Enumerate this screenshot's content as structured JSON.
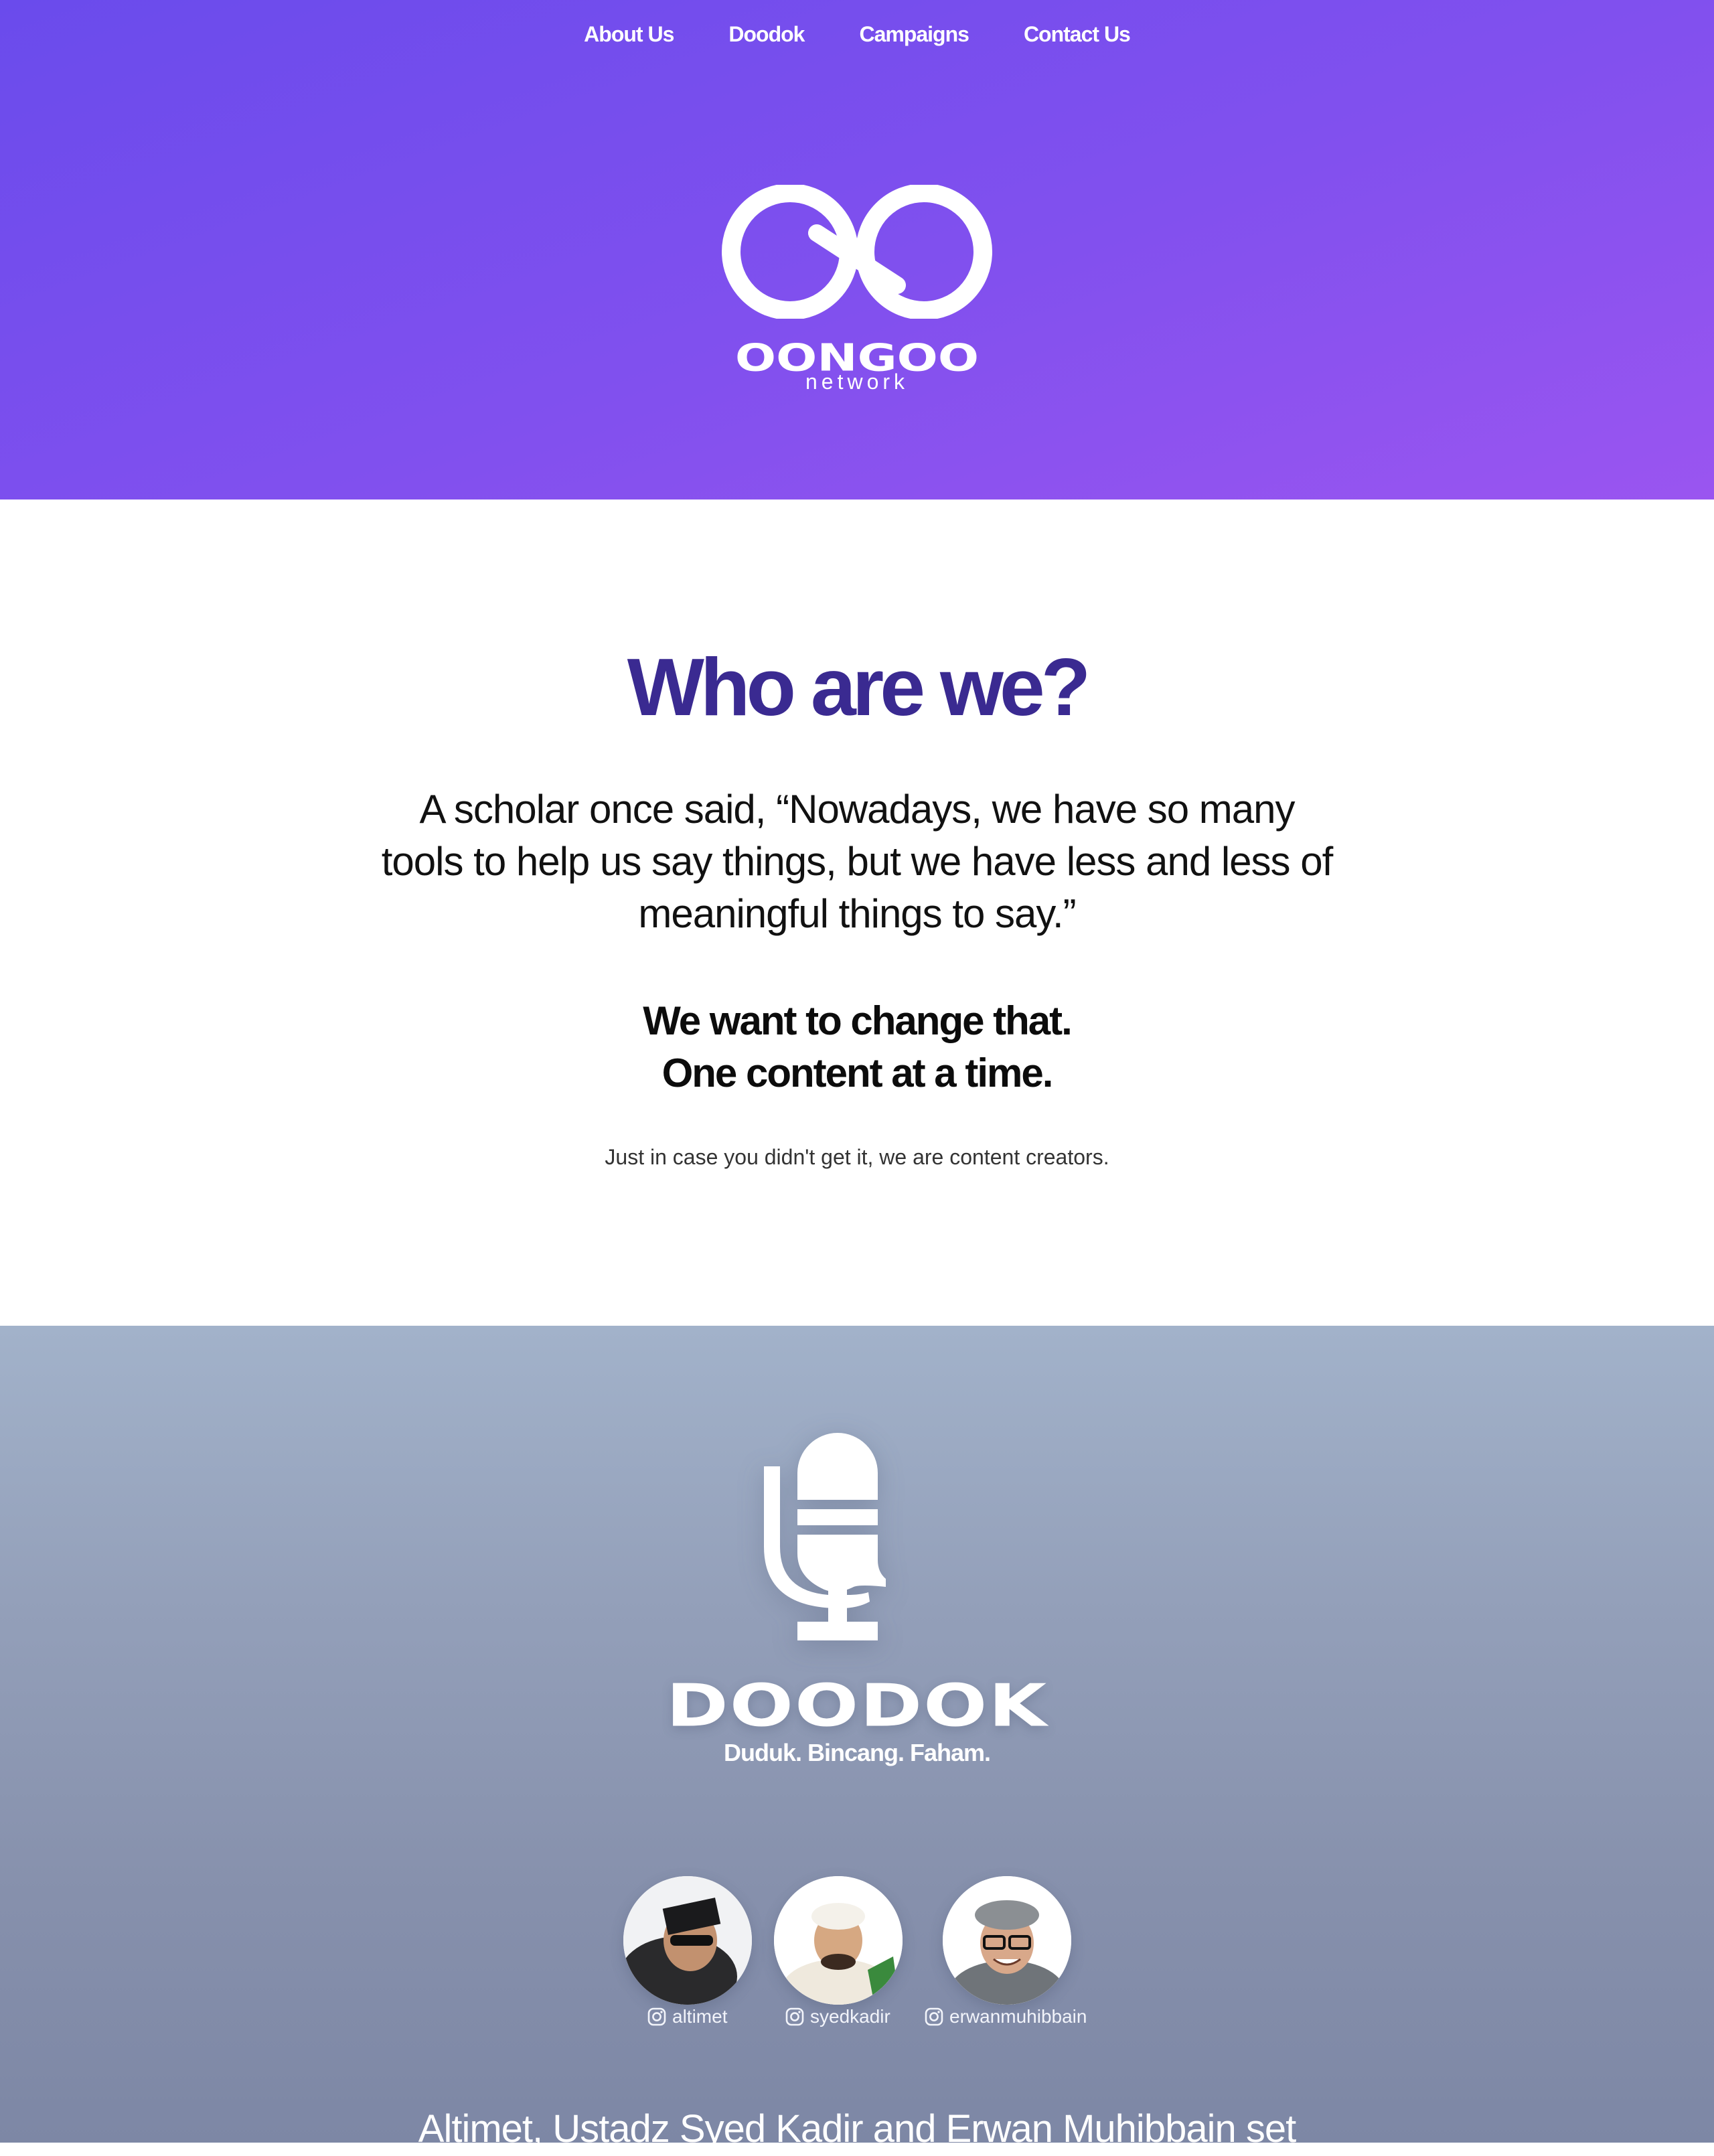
{
  "nav": {
    "items": [
      {
        "label": "About Us"
      },
      {
        "label": "Doodok"
      },
      {
        "label": "Campaigns"
      },
      {
        "label": "Contact Us"
      }
    ]
  },
  "hero": {
    "logo_word": "OONGOO",
    "logo_sub": "network",
    "colors": {
      "gradient_start": "#6a4bec",
      "gradient_end": "#9a55f0"
    }
  },
  "about": {
    "title": "Who are we?",
    "quote": "A scholar once said, “Nowadays, we have so many tools to help us say things, but we have less and less of meaningful things to say.”",
    "mission_line1": "We want to change that.",
    "mission_line2": "One content at a time.",
    "note": "Just in case you didn't get it, we are content creators.",
    "title_color": "#3a2a91"
  },
  "doodok": {
    "logo_word": "DOODOK",
    "tagline": "Duduk. Bincang. Faham.",
    "hosts": [
      {
        "handle": "altimet",
        "icon": "instagram-icon"
      },
      {
        "handle": "syedkadir",
        "icon": "instagram-icon"
      },
      {
        "handle": "erwanmuhibbain",
        "icon": "instagram-icon"
      }
    ],
    "description": "Altimet, Ustadz Syed Kadir and Erwan Muhibbain set"
  }
}
